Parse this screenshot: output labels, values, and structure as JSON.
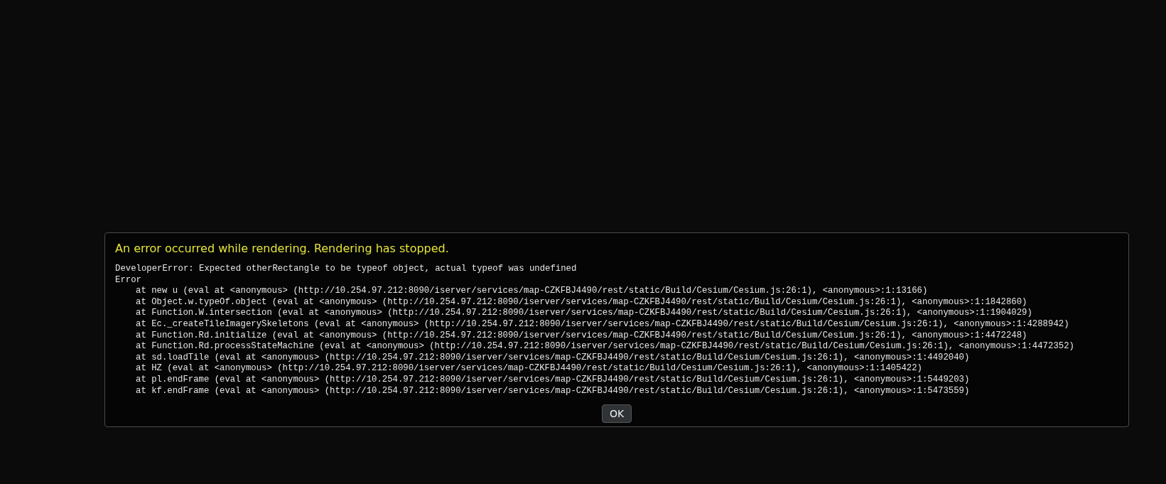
{
  "dialog": {
    "title": "An error occurred while rendering. Rendering has stopped.",
    "message": "DeveloperError: Expected otherRectangle to be typeof object, actual typeof was undefined",
    "error_label": "Error",
    "stack": [
      "at new u (eval at <anonymous> (http://10.254.97.212:8090/iserver/services/map-CZKFBJ4490/rest/static/Build/Cesium/Cesium.js:26:1), <anonymous>:1:13166)",
      "at Object.w.typeOf.object (eval at <anonymous> (http://10.254.97.212:8090/iserver/services/map-CZKFBJ4490/rest/static/Build/Cesium/Cesium.js:26:1), <anonymous>:1:1842860)",
      "at Function.W.intersection (eval at <anonymous> (http://10.254.97.212:8090/iserver/services/map-CZKFBJ4490/rest/static/Build/Cesium/Cesium.js:26:1), <anonymous>:1:1904029)",
      "at Ec._createTileImagerySkeletons (eval at <anonymous> (http://10.254.97.212:8090/iserver/services/map-CZKFBJ4490/rest/static/Build/Cesium/Cesium.js:26:1), <anonymous>:1:4288942)",
      "at Function.Rd.initialize (eval at <anonymous> (http://10.254.97.212:8090/iserver/services/map-CZKFBJ4490/rest/static/Build/Cesium/Cesium.js:26:1), <anonymous>:1:4472248)",
      "at Function.Rd.processStateMachine (eval at <anonymous> (http://10.254.97.212:8090/iserver/services/map-CZKFBJ4490/rest/static/Build/Cesium/Cesium.js:26:1), <anonymous>:1:4472352)",
      "at sd.loadTile (eval at <anonymous> (http://10.254.97.212:8090/iserver/services/map-CZKFBJ4490/rest/static/Build/Cesium/Cesium.js:26:1), <anonymous>:1:4492040)",
      "at HZ (eval at <anonymous> (http://10.254.97.212:8090/iserver/services/map-CZKFBJ4490/rest/static/Build/Cesium/Cesium.js:26:1), <anonymous>:1:1405422)",
      "at pl.endFrame (eval at <anonymous> (http://10.254.97.212:8090/iserver/services/map-CZKFBJ4490/rest/static/Build/Cesium/Cesium.js:26:1), <anonymous>:1:5449203)",
      "at kf.endFrame (eval at <anonymous> (http://10.254.97.212:8090/iserver/services/map-CZKFBJ4490/rest/static/Build/Cesium/Cesium.js:26:1), <anonymous>:1:5473559)"
    ],
    "button": "OK"
  }
}
